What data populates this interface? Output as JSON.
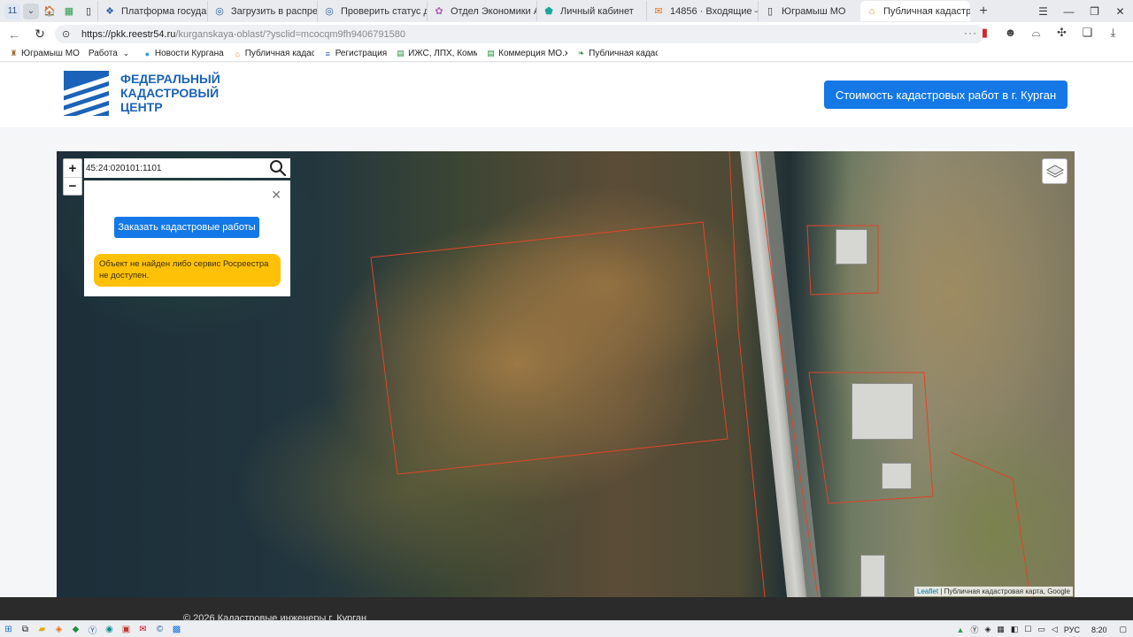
{
  "browser": {
    "tab_count": "11",
    "tabs": [
      {
        "title": "Платформа государстве"
      },
      {
        "title": "Загрузить в распределе"
      },
      {
        "title": "Проверить статус дове"
      },
      {
        "title": "Отдел Экономики Адми"
      },
      {
        "title": "Личный кабинет"
      },
      {
        "title": "14856 · Входящие — Ян"
      },
      {
        "title": "Юграмыш МО"
      },
      {
        "title": "Публичная кадастр",
        "active": true
      }
    ],
    "url_domain": "https://pkk.reestr54.ru",
    "url_path": "/kurganskaya-oblast/?ysclid=mcocqm9fh9406791580",
    "bookmarks": [
      {
        "label": "Югрaмыш МО"
      },
      {
        "label": "Работа"
      },
      {
        "label": "Новости Кургана"
      },
      {
        "label": "Публичная кадаст"
      },
      {
        "label": "Регистрация"
      },
      {
        "label": "ИЖС, ЛПХ, Коммер"
      },
      {
        "label": "Коммерция МО.xl"
      },
      {
        "label": "Публичная кадаст"
      }
    ]
  },
  "site": {
    "logo_line1": "Федеральный",
    "logo_line2": "кадастровый",
    "logo_line3": "центр",
    "cta_label": "Стоимость кадастровых работ в г. Курган"
  },
  "map": {
    "search_value": "45:24:020101:1101",
    "zoom_in": "+",
    "zoom_out": "−",
    "popup_close": "✕",
    "order_button": "Заказать кадастровые работы",
    "alert_text": "Объект не найден либо сервис Росреестра не доступен.",
    "attribution_link": "Leaflet",
    "attribution_text": " | Публичная кадастровая карта, Google",
    "parcel_color": "#e0442a"
  },
  "footer": {
    "copyright": "© 2026 Кадастровые инженеры г. Курган"
  },
  "taskbar": {
    "lang": "РУС",
    "time": "8:20"
  }
}
